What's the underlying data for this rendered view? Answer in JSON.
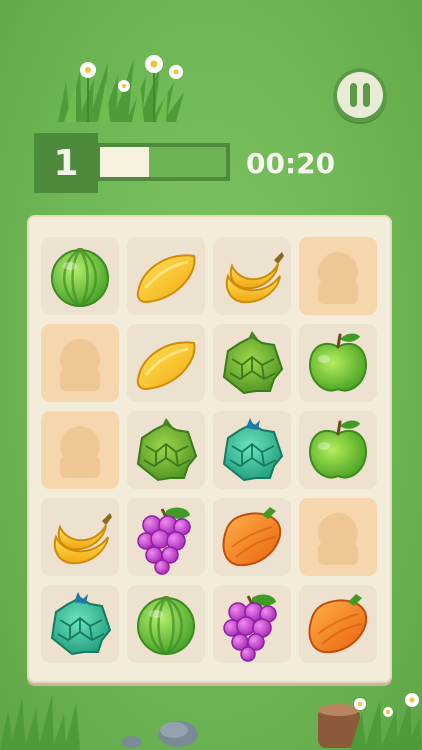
{
  "hud": {
    "level": "1",
    "timer": "00:20",
    "progress": 0.39
  },
  "pause_button": {
    "icon": "pause-icon"
  },
  "board": {
    "rows": [
      [
        "watermelon",
        "mango",
        "banana",
        "empty"
      ],
      [
        "empty",
        "mango",
        "green-durian",
        "green-apple"
      ],
      [
        "empty",
        "green-durian",
        "teal-durian",
        "green-apple"
      ],
      [
        "banana",
        "grapes",
        "orange-papaya",
        "empty"
      ],
      [
        "teal-durian",
        "watermelon",
        "grapes",
        "orange-papaya"
      ]
    ]
  },
  "colors": {
    "background": "#6db553",
    "hud_dark": "#4d8a3c",
    "board": "#f4ecdb",
    "tile": "#ece2cf",
    "empty_tile": "#f6d6ad"
  }
}
